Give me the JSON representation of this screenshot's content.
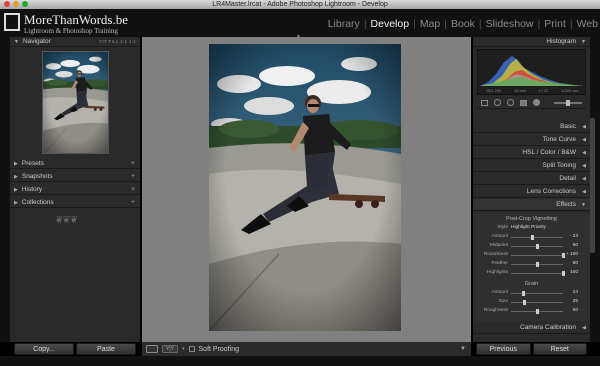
{
  "window": {
    "title": "LR4Master.lrcat - Adobe Photoshop Lightroom - Develop"
  },
  "identity": {
    "title": "MoreThanWords.be",
    "subtitle": "Lightroom & Photoshop Training"
  },
  "modules": [
    "Library",
    "Develop",
    "Map",
    "Book",
    "Slideshow",
    "Print",
    "Web"
  ],
  "active_module": "Develop",
  "left_panel": {
    "navigator": {
      "label": "Navigator",
      "tools": "FIT  FILL  1:1  1:1"
    },
    "sections": [
      {
        "label": "Presets",
        "action": "+"
      },
      {
        "label": "Snapshots",
        "action": "+"
      },
      {
        "label": "History",
        "action": "×"
      },
      {
        "label": "Collections",
        "action": "+"
      }
    ],
    "ornament": "❦❦❦",
    "copy_label": "Copy...",
    "paste_label": "Paste"
  },
  "toolbar": {
    "proof_label": "Soft Proofing",
    "yy_label": "Y|Y"
  },
  "right_panel": {
    "histogram": {
      "label": "Histogram",
      "info": [
        "ISO 200",
        "16 mm",
        "f / 22",
        "1/200 sec"
      ]
    },
    "sections": [
      "Basic",
      "Tone Curve",
      "HSL / Color / B&W",
      "Split Toning",
      "Detail",
      "Lens Corrections",
      "Effects"
    ],
    "post_crop": {
      "title": "Post-Crop Vignetting",
      "style_label": "Style",
      "style_value": "Highlight Priority",
      "sliders": [
        {
          "label": "Amount",
          "value": "- 23",
          "pos": 0.42
        },
        {
          "label": "Midpoint",
          "value": "50",
          "pos": 0.5
        },
        {
          "label": "Roundness",
          "value": "+ 100",
          "pos": 1.0
        },
        {
          "label": "Feather",
          "value": "50",
          "pos": 0.5
        },
        {
          "label": "Highlights",
          "value": "100",
          "pos": 1.0
        }
      ]
    },
    "grain": {
      "title": "Grain",
      "sliders": [
        {
          "label": "Amount",
          "value": "24",
          "pos": 0.24
        },
        {
          "label": "Size",
          "value": "25",
          "pos": 0.25
        },
        {
          "label": "Roughness",
          "value": "50",
          "pos": 0.5
        }
      ]
    },
    "camera_calibration": "Camera Calibration",
    "previous_label": "Previous",
    "reset_label": "Reset"
  },
  "colors": {
    "accent": "#f0f0f0",
    "panel": "#2a2a2a",
    "background": "#808080"
  }
}
